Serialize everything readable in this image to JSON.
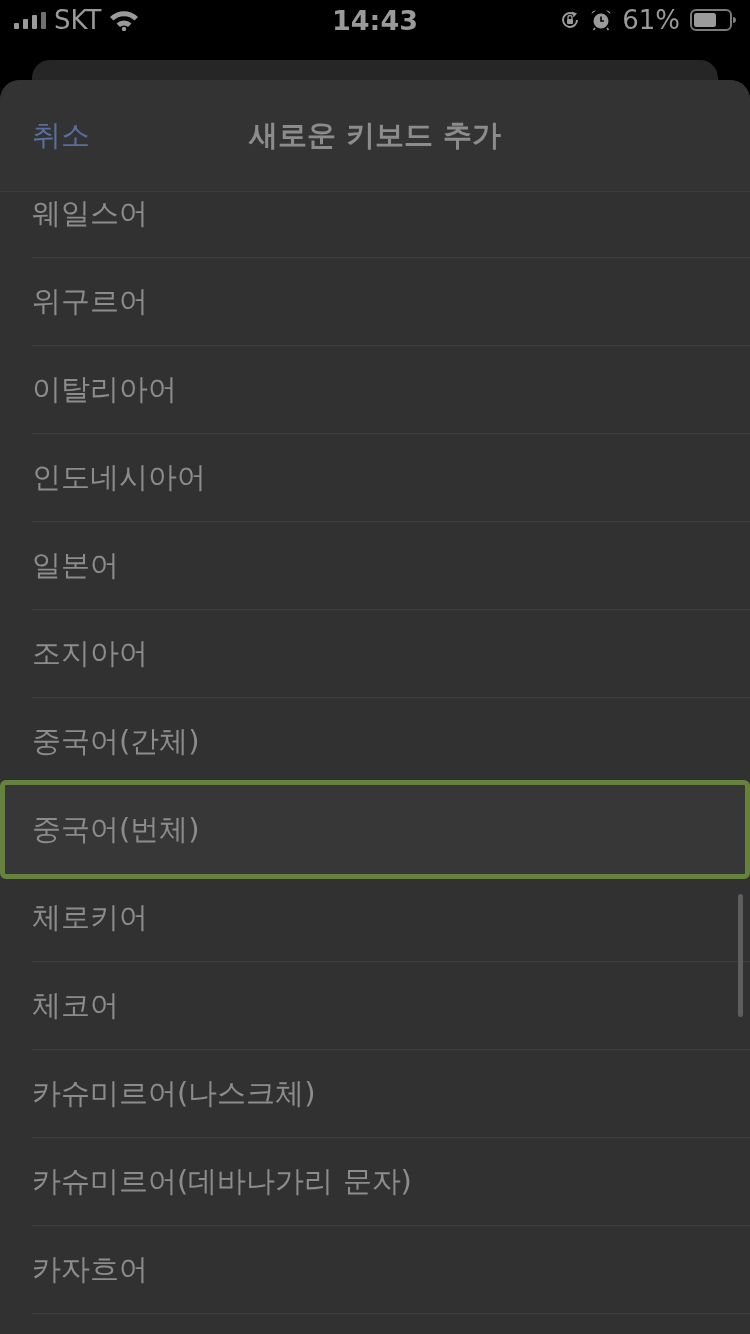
{
  "status_bar": {
    "carrier": "SKT",
    "time": "14:43",
    "battery_percent": "61%"
  },
  "sheet": {
    "cancel": "취소",
    "title": "새로운 키보드 추가"
  },
  "languages": [
    {
      "label": "웨일스어",
      "highlighted": false
    },
    {
      "label": "위구르어",
      "highlighted": false
    },
    {
      "label": "이탈리아어",
      "highlighted": false
    },
    {
      "label": "인도네시아어",
      "highlighted": false
    },
    {
      "label": "일본어",
      "highlighted": false
    },
    {
      "label": "조지아어",
      "highlighted": false
    },
    {
      "label": "중국어(간체)",
      "highlighted": false
    },
    {
      "label": "중국어(번체)",
      "highlighted": true
    },
    {
      "label": "체로키어",
      "highlighted": false
    },
    {
      "label": "체코어",
      "highlighted": false
    },
    {
      "label": "카슈미르어(나스크체)",
      "highlighted": false
    },
    {
      "label": "카슈미르어(데바나가리 문자)",
      "highlighted": false
    },
    {
      "label": "카자흐어",
      "highlighted": false
    }
  ]
}
